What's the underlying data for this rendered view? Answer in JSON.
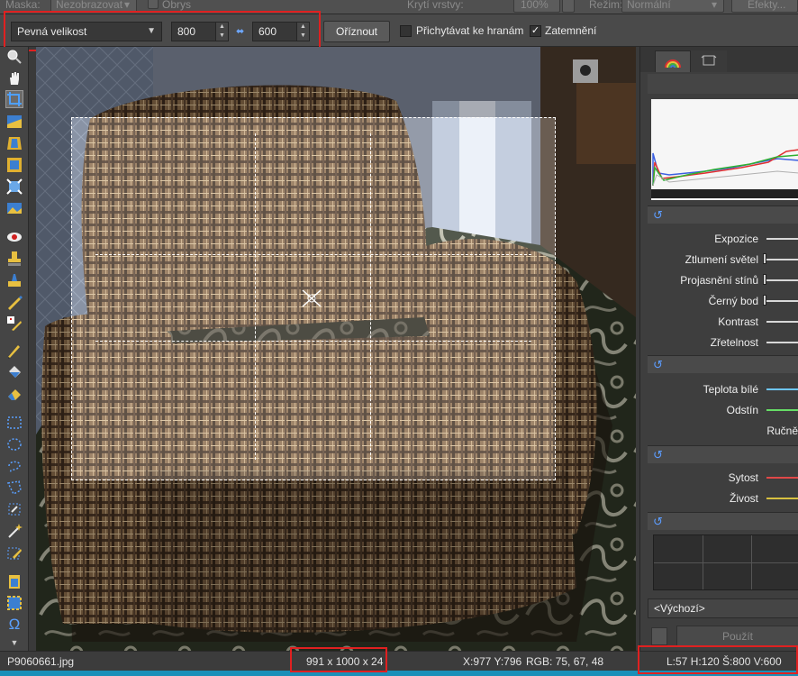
{
  "topbar": {
    "mask_label": "Maska:",
    "mask_value": "Nezobrazovat",
    "outline_label": "Obrys",
    "opacity_label": "Krytí vrstvy:",
    "opacity_value": "100%",
    "mode_label": "Režim:",
    "mode_value": "Normální",
    "effects_label": "Efekty..."
  },
  "toolbar": {
    "size_mode": "Pevná velikost",
    "width": "800",
    "height": "600",
    "crop_button": "Oříznout",
    "snap_label": "Přichytávat ke hranám",
    "snap_checked": false,
    "darken_label": "Zatemnění",
    "darken_checked": true
  },
  "tools": [
    "zoom-tool-icon",
    "hand-tool-icon",
    "crop-tool-icon",
    "straighten-tool-icon",
    "perspective-tool-icon",
    "resize-tool-icon",
    "transform-tool-icon",
    "image-adjust-icon",
    "red-eye-tool-icon",
    "clone-stamp-icon",
    "brush-tool-icon",
    "heal-brush-icon",
    "retouch-tool-icon",
    "pencil-tool-icon",
    "fill-bucket-icon",
    "eraser-tool-icon",
    "rect-select-icon",
    "ellipse-select-icon",
    "lasso-select-icon",
    "polygon-select-icon",
    "magic-select-icon",
    "magic-wand-icon",
    "edit-select-icon",
    "layer-paste-icon",
    "layer-select-icon",
    "text-tool-icon"
  ],
  "panel": {
    "sliders_exposure": [
      {
        "label": "Expozice",
        "color": "#ffffff"
      },
      {
        "label": "Ztlumení světel",
        "color": "#ffffff"
      },
      {
        "label": "Projasnění stínů",
        "color": "#ffffff"
      },
      {
        "label": "Černý bod",
        "color": "#ffffff"
      },
      {
        "label": "Kontrast",
        "color": "#ffffff"
      },
      {
        "label": "Zřetelnost",
        "color": "#ffffff"
      }
    ],
    "sliders_color": [
      {
        "label": "Teplota bílé",
        "color": "#6ec6ff"
      },
      {
        "label": "Odstín",
        "color": "#66dd66"
      },
      {
        "label": "Ručně",
        "color": ""
      }
    ],
    "sliders_saturation": [
      {
        "label": "Sytost",
        "color": "#e04848"
      },
      {
        "label": "Živost",
        "color": "#d8c040"
      }
    ],
    "preset": "<Výchozí>",
    "apply_button": "Použít"
  },
  "status": {
    "filename": "P9060661.jpg",
    "dimensions": "991 x 1000 x 24",
    "cursor": "X:977 Y:796",
    "rgb": "RGB: 75, 67, 48",
    "selection": "L:57  H:120  Š:800  V:600"
  }
}
